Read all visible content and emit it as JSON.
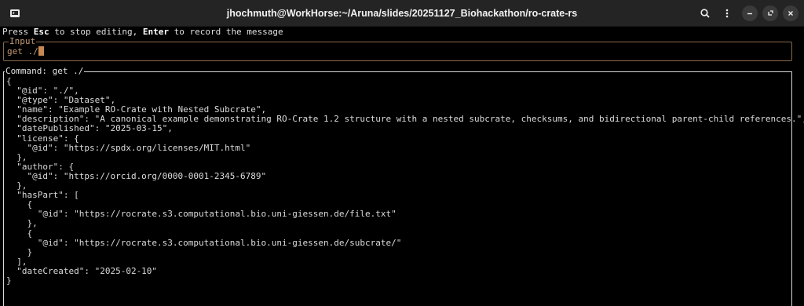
{
  "window": {
    "title": "jhochmuth@WorkHorse:~/Aruna/slides/20251127_Biohackathon/ro-crate-rs",
    "icons": [
      "terminal-icon",
      "search-icon",
      "kebab-menu-icon",
      "minimize-icon",
      "restore-icon",
      "close-icon"
    ]
  },
  "hint": {
    "part1": "Press ",
    "key1": "Esc",
    "part2": " to stop editing, ",
    "key2": "Enter",
    "part3": " to record the message"
  },
  "input": {
    "label": "Input",
    "value": "get ./"
  },
  "command": {
    "label": "Command: get ./",
    "lines": [
      "{",
      "  \"@id\": \"./\",",
      "  \"@type\": \"Dataset\",",
      "  \"name\": \"Example RO-Crate with Nested Subcrate\",",
      "  \"description\": \"A canonical example demonstrating RO-Crate 1.2 structure with a nested subcrate, checksums, and bidirectional parent-child references.\",",
      "  \"datePublished\": \"2025-03-15\",",
      "  \"license\": {",
      "    \"@id\": \"https://spdx.org/licenses/MIT.html\"",
      "  },",
      "  \"author\": {",
      "    \"@id\": \"https://orcid.org/0000-0001-2345-6789\"",
      "  },",
      "  \"hasPart\": [",
      "    {",
      "      \"@id\": \"https://rocrate.s3.computational.bio.uni-giessen.de/file.txt\"",
      "    },",
      "    {",
      "      \"@id\": \"https://rocrate.s3.computational.bio.uni-giessen.de/subcrate/\"",
      "    }",
      "  ],",
      "  \"dateCreated\": \"2025-02-10\"",
      "}"
    ]
  },
  "colors": {
    "input_border": "#8a6a4a",
    "input_text": "#c29a72",
    "cursor": "#c58a52",
    "titlebar": "#242424"
  }
}
